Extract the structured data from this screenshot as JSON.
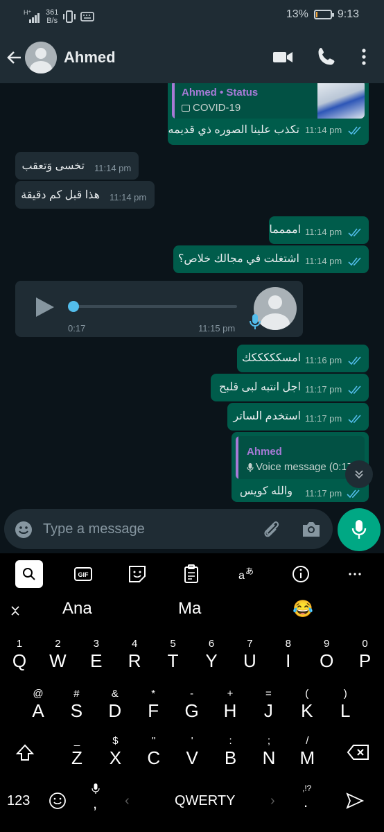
{
  "status_bar": {
    "net_speed_value": "361",
    "net_speed_unit": "B/s",
    "battery": "13%",
    "battery_level": 0.13,
    "time": "9:13"
  },
  "header": {
    "contact_name": "Ahmed"
  },
  "messages": [
    {
      "quote_author": "Ahmed • Status",
      "quote_text": "COVID-19",
      "text": "تكذب علينا الصوره ذي قديمه",
      "time": "11:14 pm"
    },
    {
      "text": "تخسى وَتعقب",
      "time": "11:14 pm"
    },
    {
      "text": "هذا قبل كم دقيقة",
      "time": "11:14 pm"
    },
    {
      "text": "امممما",
      "time": "11:14 pm"
    },
    {
      "text": "اشتغلت في مجالك خلاص؟",
      "time": "11:14 pm"
    },
    {
      "duration": "0:17",
      "time": "11:15 pm"
    },
    {
      "text": "امسكككككك",
      "time": "11:16 pm"
    },
    {
      "text": "اجل انتبه لبى قلبح",
      "time": "11:17 pm"
    },
    {
      "text": "استخدم الساتر",
      "time": "11:17 pm"
    },
    {
      "quote_author": "Ahmed",
      "quote_text": "Voice message (0:17)",
      "text": "والله كويس",
      "time": "11:17 pm"
    }
  ],
  "composer": {
    "placeholder": "Type a message"
  },
  "keyboard": {
    "suggestions": [
      "Ana",
      "Ma",
      "😂"
    ],
    "row1": [
      [
        "1",
        "Q"
      ],
      [
        "2",
        "W"
      ],
      [
        "3",
        "E"
      ],
      [
        "4",
        "R"
      ],
      [
        "5",
        "T"
      ],
      [
        "6",
        "Y"
      ],
      [
        "7",
        "U"
      ],
      [
        "8",
        "I"
      ],
      [
        "9",
        "O"
      ],
      [
        "0",
        "P"
      ]
    ],
    "row2": [
      [
        "@",
        "A"
      ],
      [
        "#",
        "S"
      ],
      [
        "&",
        "D"
      ],
      [
        "*",
        "F"
      ],
      [
        "-",
        "G"
      ],
      [
        "+",
        "H"
      ],
      [
        "=",
        "J"
      ],
      [
        "(",
        "K"
      ],
      [
        ")",
        "L"
      ]
    ],
    "row3": [
      [
        "_",
        "Z"
      ],
      [
        "$",
        "X"
      ],
      [
        "\"",
        "C"
      ],
      [
        "'",
        "V"
      ],
      [
        ":",
        "B"
      ],
      [
        ";",
        "N"
      ],
      [
        "/",
        "M"
      ]
    ],
    "numbers_label": "123",
    "layout_label": "QWERTY",
    "punct_label": ",!?",
    "comma_label": ","
  },
  "colors": {
    "outgoing": "#005c4b",
    "incoming": "#1f2c34",
    "accent": "#00a884",
    "read_ticks": "#53bdeb"
  }
}
